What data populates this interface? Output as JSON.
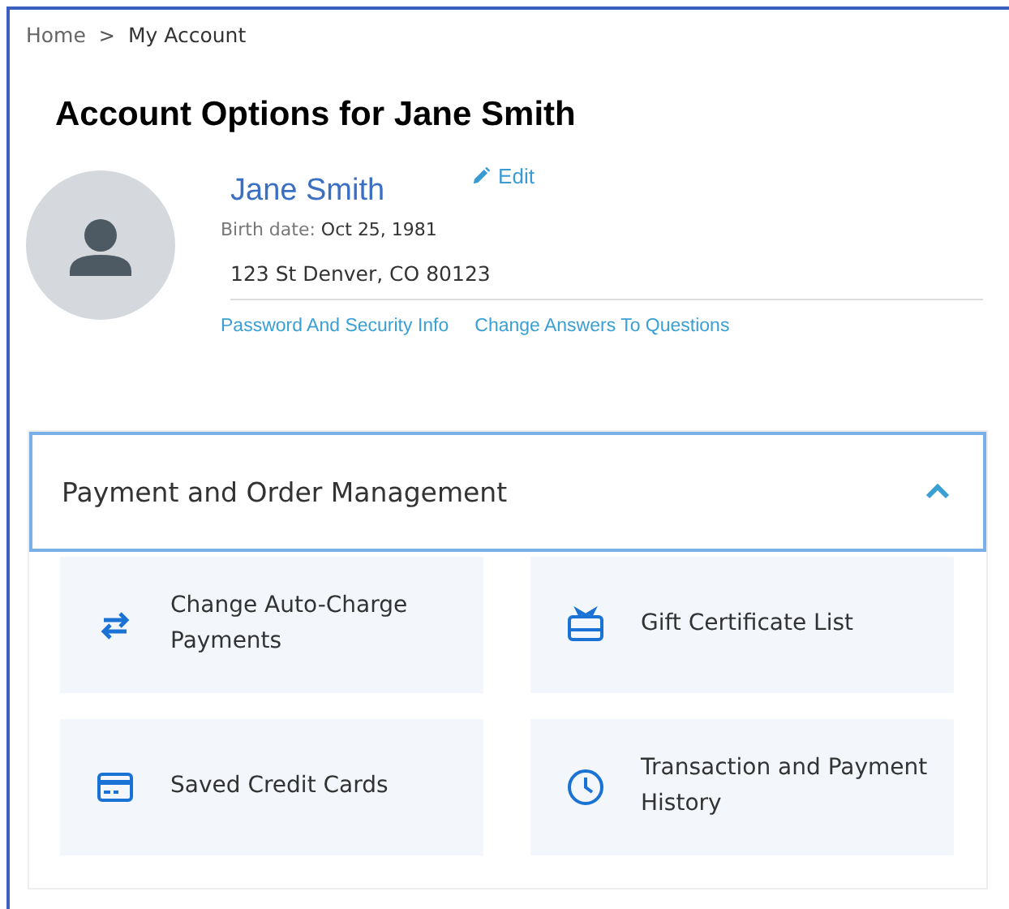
{
  "breadcrumb": [
    {
      "label": "Home",
      "current": false
    },
    {
      "label": ">",
      "kind": "separator"
    },
    {
      "label": "My Account",
      "current": true
    }
  ],
  "title": "Account Options for Jane Smith",
  "profile": {
    "name": "Jane Smith",
    "edit": "Edit",
    "birth_label": "Birth date:",
    "birth_date": "Oct 25, 1981",
    "address": "123 St Denver, CO 80123",
    "links": [
      "Password And Security Info",
      "Change Answers To Questions"
    ]
  },
  "section": {
    "title": "Payment and Order Management",
    "expanded": true,
    "options": [
      {
        "label": "Change Auto-Charge Payments",
        "kind": "transfer"
      },
      {
        "label": "Gift Certificate List",
        "kind": "gift"
      },
      {
        "label": "Saved Credit Cards",
        "kind": "card"
      },
      {
        "label": "Transaction and Payment History",
        "kind": "clock"
      }
    ]
  }
}
